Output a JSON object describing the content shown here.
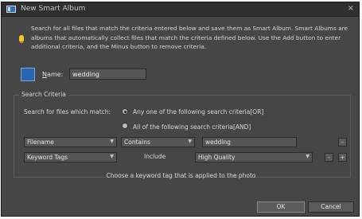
{
  "window": {
    "title": "New Smart Album",
    "close_glyph": "×"
  },
  "instructions": "Search for all files that match the criteria entered below and save them as Smart Album. Smart Albums are albums that automatically collect files that match the criteria defined below. Use the Add button to enter additional criteria, and the Minus button to remove criteria.",
  "name": {
    "label_underlined": "N",
    "label_rest": "ame:",
    "value": "wedding"
  },
  "criteria": {
    "legend": "Search Criteria",
    "search_label": "Search for files which match:",
    "options": [
      {
        "label": "Any one of the following search criteria[OR]",
        "underlined": "A",
        "checked": true
      },
      {
        "label": "All of the following search criteria[AND]",
        "underlined": "l",
        "checked": false
      }
    ],
    "rows": [
      {
        "field": "Filename",
        "operator": "Contains",
        "value": "wedding",
        "buttons": [
          "-"
        ]
      },
      {
        "field": "Keyword Tags",
        "operator": "Include",
        "value": "High Quality",
        "buttons": [
          "-",
          "+"
        ]
      }
    ],
    "hint": "Choose a keyword tag that is applied to the photo"
  },
  "buttons": {
    "ok": "OK",
    "cancel": "Cancel"
  },
  "colors": {
    "dialog_bg": "#464646",
    "titlebar_bg": "#2f2f2f",
    "field_bg": "#555555",
    "info_icon": "#f4c530",
    "album_icon": "#2a66b0"
  },
  "icons": {
    "window": "album-icon",
    "info": "lightbulb-icon",
    "album": "smart-album-icon",
    "close": "close-icon"
  }
}
